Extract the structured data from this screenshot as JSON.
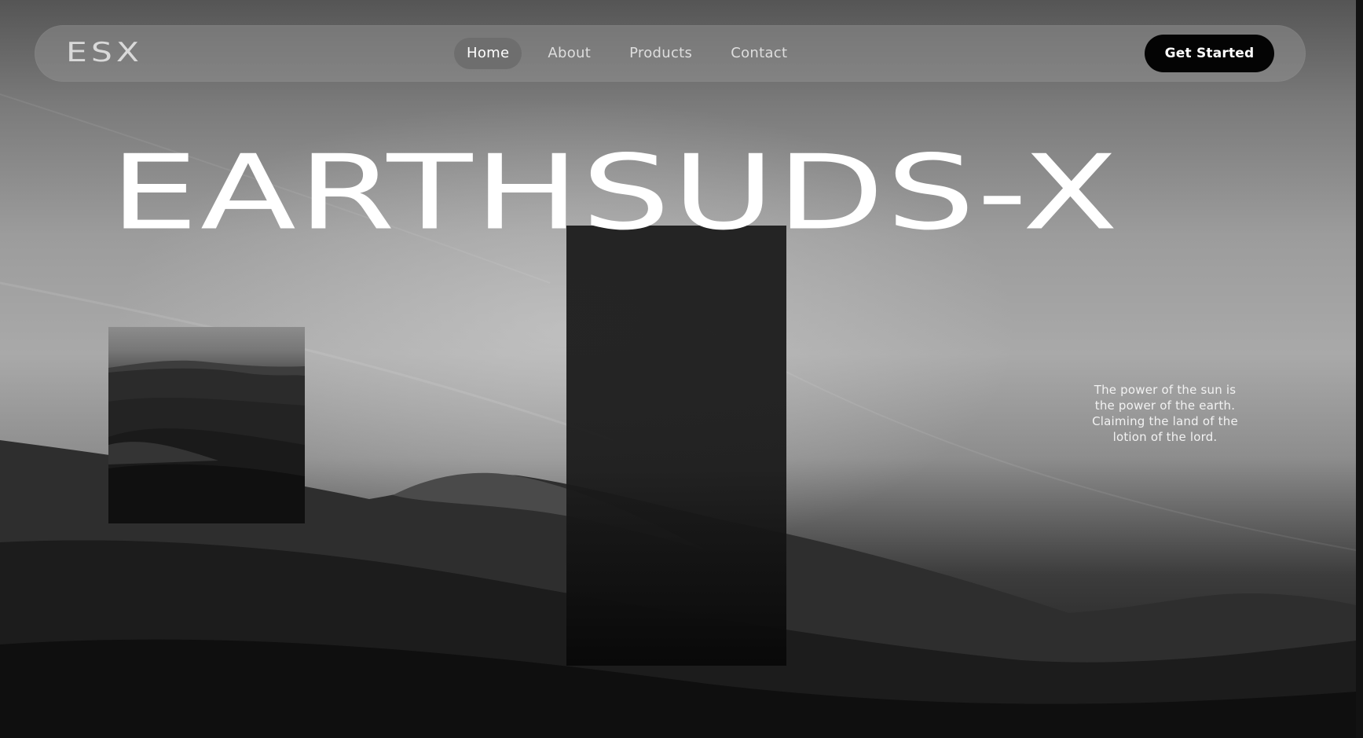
{
  "brand": {
    "logo": "ESX"
  },
  "nav": {
    "items": [
      {
        "label": "Home",
        "active": true
      },
      {
        "label": "About",
        "active": false
      },
      {
        "label": "Products",
        "active": false
      },
      {
        "label": "Contact",
        "active": false
      }
    ],
    "cta_label": "Get Started"
  },
  "hero": {
    "headline": "EARTHSUDS-X",
    "tagline": "The power of the sun is the power of the earth. Claiming the land of the lotion of the lord."
  },
  "colors": {
    "cta_background": "#040404",
    "active_pill": "#6e6e6e",
    "text_light": "#ffffff"
  }
}
